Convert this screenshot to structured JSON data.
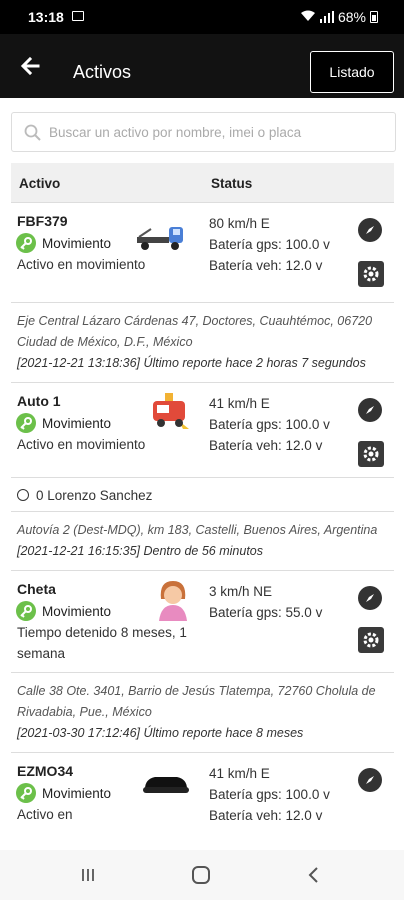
{
  "status_bar": {
    "time": "13:18",
    "battery": "68%"
  },
  "app_bar": {
    "title": "Activos",
    "list_button": "Listado"
  },
  "search": {
    "placeholder": "Buscar un activo por nombre, imei o placa"
  },
  "table": {
    "headers": {
      "asset": "Activo",
      "status": "Status"
    },
    "assets": [
      {
        "name": "FBF379",
        "mode": "Movimiento",
        "state": "Activo en movimiento",
        "icon": "tow-truck-icon",
        "speed": "80 km/h E",
        "battery_gps": "Batería gps: 100.0 v",
        "battery_veh": "Batería veh: 12.0 v",
        "address": "Eje Central Lázaro Cárdenas 47, Doctores, Cuauhtémoc, 06720 Ciudad de México, D.F., México",
        "report": "[2021-12-21 13:18:36] Último reporte hace 2 horas 7 segundos"
      },
      {
        "name": "Auto 1",
        "mode": "Movimiento",
        "state": "Activo en movimiento",
        "icon": "ambulance-icon",
        "speed": "41 km/h E",
        "battery_gps": "Batería gps: 100.0 v",
        "battery_veh": "Batería veh: 12.0 v",
        "driver": "0 Lorenzo Sanchez",
        "address": "Autovía 2 (Dest-MDQ), km 183, Castelli, Buenos Aires, Argentina",
        "report": "[2021-12-21 16:15:35] Dentro de 56 minutos"
      },
      {
        "name": "Cheta",
        "mode": "Movimiento",
        "state": "Tiempo detenido 8 meses, 1 semana",
        "icon": "woman-avatar-icon",
        "speed": "3 km/h NE",
        "battery_gps": "Batería gps: 55.0 v",
        "address": "Calle 38 Ote. 3401, Barrio de Jesús Tlatempa, 72760 Cholula de Rivadabia, Pue., México",
        "report": "[2021-03-30 17:12:46] Último reporte hace 8 meses"
      },
      {
        "name": "EZMO34",
        "mode": "Movimiento",
        "state": "Activo en",
        "icon": "car-icon",
        "speed": "41 km/h E",
        "battery_gps": "Batería gps: 100.0 v",
        "battery_veh": "Batería veh: 12.0 v"
      }
    ]
  },
  "colors": {
    "app_bar": "#121212",
    "key_badge": "#6cc04a",
    "action_icon": "#333333"
  }
}
